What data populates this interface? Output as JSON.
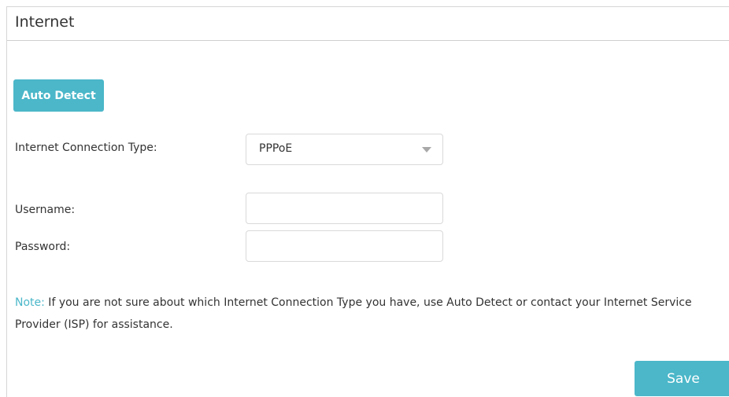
{
  "page": {
    "title": "Internet"
  },
  "buttons": {
    "auto_detect_label": "Auto Detect",
    "save_label": "Save"
  },
  "form": {
    "connection_type_label": "Internet Connection Type:",
    "connection_type_value": "PPPoE",
    "username_label": "Username:",
    "username_value": "",
    "password_label": "Password:",
    "password_value": ""
  },
  "note": {
    "label": "Note:",
    "text": " If you are not sure about which Internet Connection Type you have, use Auto Detect or contact your Internet Service Provider (ISP) for assistance."
  },
  "colors": {
    "accent": "#4bb7c9",
    "text": "#333333",
    "border": "#d9d9d9"
  },
  "icons": {
    "select_caret": "chevron-down-icon"
  }
}
